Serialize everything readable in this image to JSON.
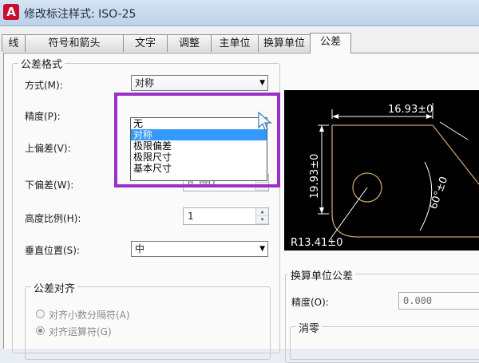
{
  "window": {
    "title": "修改标注样式: ISO-25",
    "app_icon": "A"
  },
  "tabs": [
    {
      "label": "线"
    },
    {
      "label": "符号和箭头"
    },
    {
      "label": "文字"
    },
    {
      "label": "调整"
    },
    {
      "label": "主单位"
    },
    {
      "label": "换算单位"
    },
    {
      "label": "公差"
    }
  ],
  "tolerance_format": {
    "title": "公差格式",
    "method_label": "方式(M):",
    "method_value": "对称",
    "method_options": [
      "无",
      "对称",
      "极限偏差",
      "极限尺寸",
      "基本尺寸"
    ],
    "method_selected_index": 1,
    "precision_label": "精度(P):",
    "upper_label": "上偏差(V):",
    "lower_label": "下偏差(W):",
    "lower_value": "0.001",
    "scale_label": "高度比例(H):",
    "scale_value": "1",
    "vpos_label": "垂直位置(S):",
    "vpos_value": "中"
  },
  "alignment": {
    "title": "公差对齐",
    "opt1": "对齐小数分隔符(A)",
    "opt2": "对齐运算符(G)"
  },
  "alt_units": {
    "title": "换算单位公差",
    "precision_label": "精度(O):",
    "precision_value": "0.000",
    "zero_title": "消零"
  },
  "preview": {
    "dim_top": "16.93±0",
    "dim_left": "19.93±0",
    "dim_angle": "60°±0",
    "dim_radius": "R13.41±0",
    "line_color": "#ffffff",
    "accent_color": "#c8a26a"
  },
  "colors": {
    "highlight": "#9b30c8",
    "selection": "#3399ff"
  }
}
